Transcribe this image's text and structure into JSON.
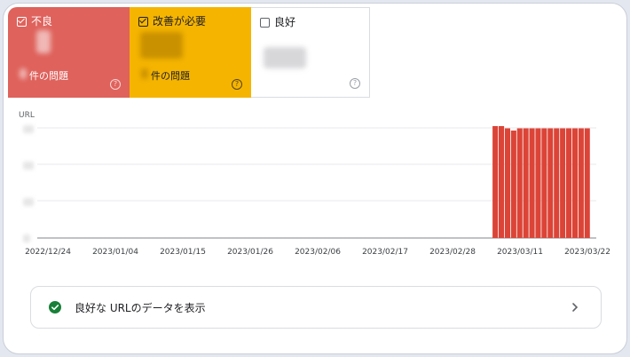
{
  "tiles": {
    "poor": {
      "label": "不良",
      "sub": "件の問題",
      "help": "?"
    },
    "needs_improvement": {
      "label": "改善が必要",
      "sub": "件の問題",
      "help": "?"
    },
    "good": {
      "label": "良好",
      "help": "?"
    }
  },
  "colors": {
    "poor": "#df625c",
    "needs_improvement": "#f5b400",
    "bar": "#db4437",
    "success": "#188038"
  },
  "chart_data": {
    "type": "bar",
    "ylabel": "URL",
    "x_tick_labels": [
      "2022/12/24",
      "2023/01/04",
      "2023/01/15",
      "2023/01/26",
      "2023/02/06",
      "2023/02/17",
      "2023/02/28",
      "2023/03/11",
      "2023/03/22"
    ],
    "dates": [
      "2023/03/07",
      "2023/03/08",
      "2023/03/09",
      "2023/03/10",
      "2023/03/11",
      "2023/03/12",
      "2023/03/13",
      "2023/03/14",
      "2023/03/15",
      "2023/03/16",
      "2023/03/17",
      "2023/03/18",
      "2023/03/19",
      "2023/03/20",
      "2023/03/21",
      "2023/03/22"
    ],
    "values": [
      1.0,
      1.0,
      0.98,
      0.96,
      0.98,
      0.98,
      0.98,
      0.98,
      0.98,
      0.98,
      0.98,
      0.98,
      0.98,
      0.98,
      0.98,
      0.98
    ],
    "y_relative_max": 1.0,
    "grid": true,
    "legend": "none"
  },
  "cta": {
    "label": "良好な URLのデータを表示",
    "icon": "check-circle-icon",
    "chevron": "chevron-right-icon"
  }
}
